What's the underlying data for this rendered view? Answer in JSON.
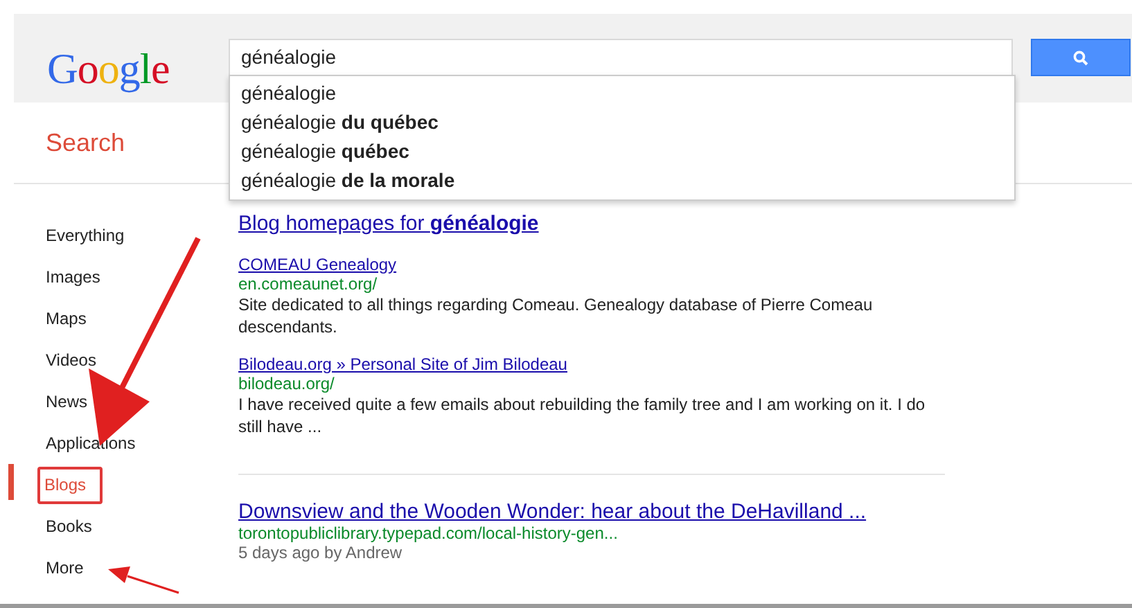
{
  "header": {
    "logo": "Google",
    "search": {
      "value": "généalogie"
    },
    "suggestions": [
      "généalogie",
      "généalogie **du québec**",
      "généalogie **québec**",
      "généalogie **de la morale**"
    ]
  },
  "nav_title": "Search",
  "sidebar": {
    "items": [
      {
        "label": "Everything",
        "selected": false
      },
      {
        "label": "Images",
        "selected": false
      },
      {
        "label": "Maps",
        "selected": false
      },
      {
        "label": "Videos",
        "selected": false
      },
      {
        "label": "News",
        "selected": false
      },
      {
        "label": "Applications",
        "selected": false
      },
      {
        "label": "Blogs",
        "selected": true
      },
      {
        "label": "Books",
        "selected": false
      },
      {
        "label": "More",
        "selected": false
      }
    ]
  },
  "results": {
    "heading": "Blog homepages for **généalogie**",
    "blog_results": [
      {
        "title": "COMEAU Genealogy",
        "url": "en.comeaunet.org/",
        "snippet": "Site dedicated to all things regarding Comeau. Genealogy database of Pierre Comeau descendants."
      },
      {
        "title": "Bilodeau.org » Personal Site of Jim Bilodeau",
        "url": "bilodeau.org/",
        "snippet": "I have received quite a few emails about rebuilding the family tree and I am working on it. I do still have ..."
      }
    ],
    "post": {
      "title": "Downsview and the Wooden Wonder: hear about the DeHavilland ...",
      "url": "torontopubliclibrary.typepad.com/local-history-gen...",
      "meta": "5 days ago by Andrew"
    }
  }
}
